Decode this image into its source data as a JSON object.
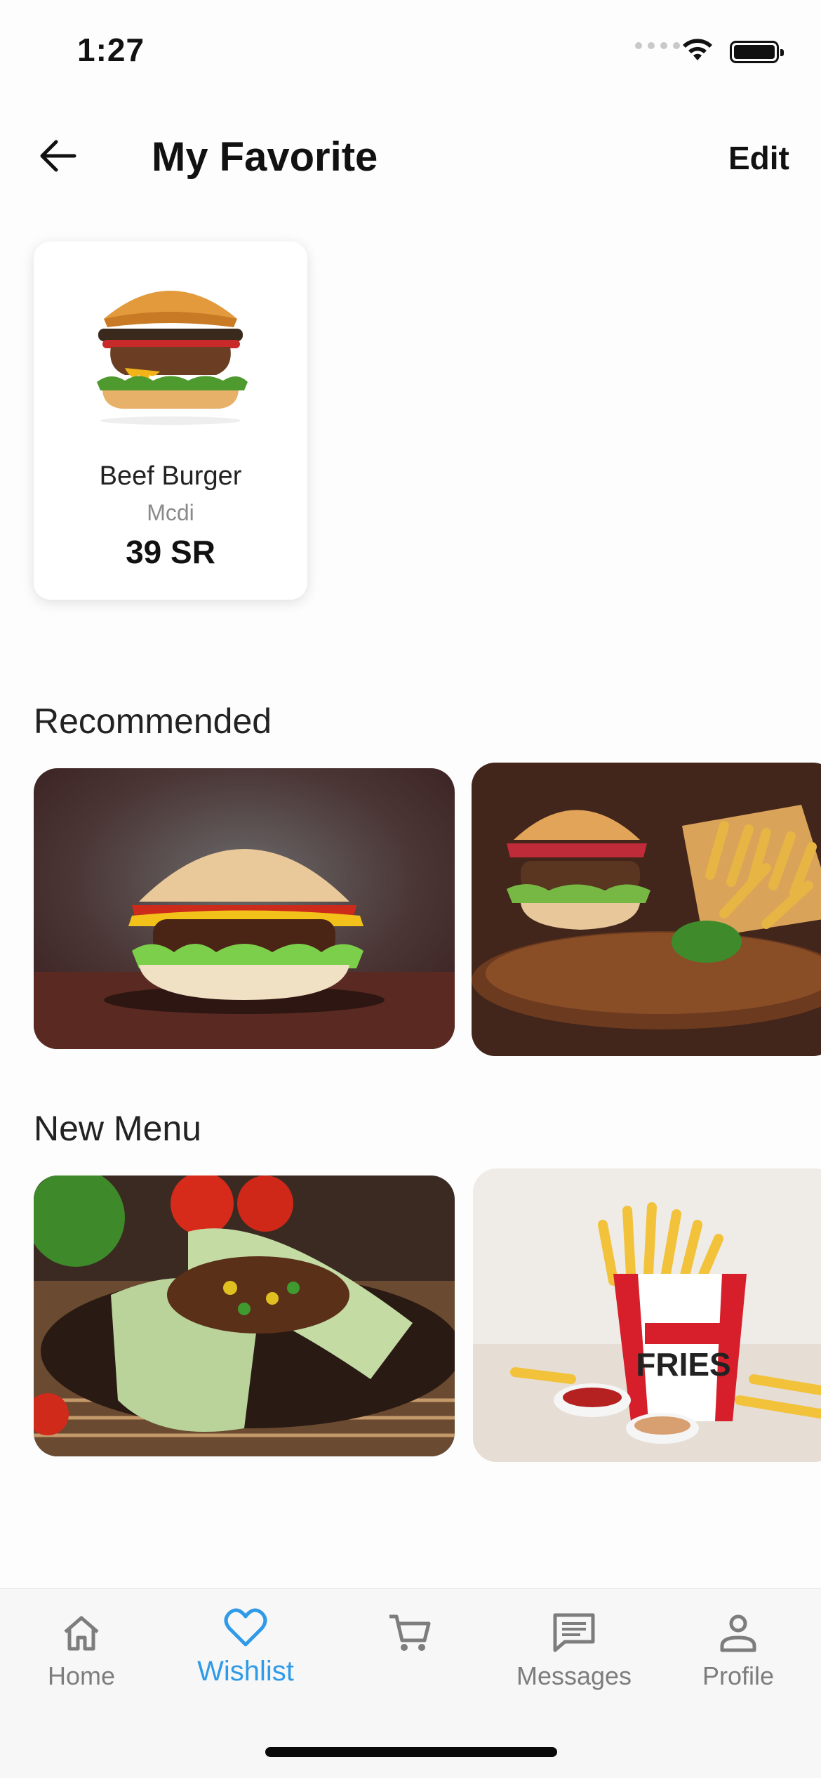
{
  "status": {
    "time": "1:27"
  },
  "header": {
    "title": "My Favorite",
    "edit_label": "Edit"
  },
  "favorites": [
    {
      "name": "Beef Burger",
      "restaurant": "Mcdi",
      "price": "39 SR"
    }
  ],
  "recommended": {
    "title": "Recommended"
  },
  "new_menu": {
    "title": "New Menu"
  },
  "nav": {
    "items": [
      {
        "label": "Home",
        "icon": "home-icon"
      },
      {
        "label": "Wishlist",
        "icon": "heart-icon",
        "active": true
      },
      {
        "label": "",
        "icon": "cart-icon"
      },
      {
        "label": "Messages",
        "icon": "message-icon"
      },
      {
        "label": "Profile",
        "icon": "profile-icon"
      }
    ]
  },
  "colors": {
    "accent": "#2f9be8",
    "inactive": "#7d7d7d"
  }
}
